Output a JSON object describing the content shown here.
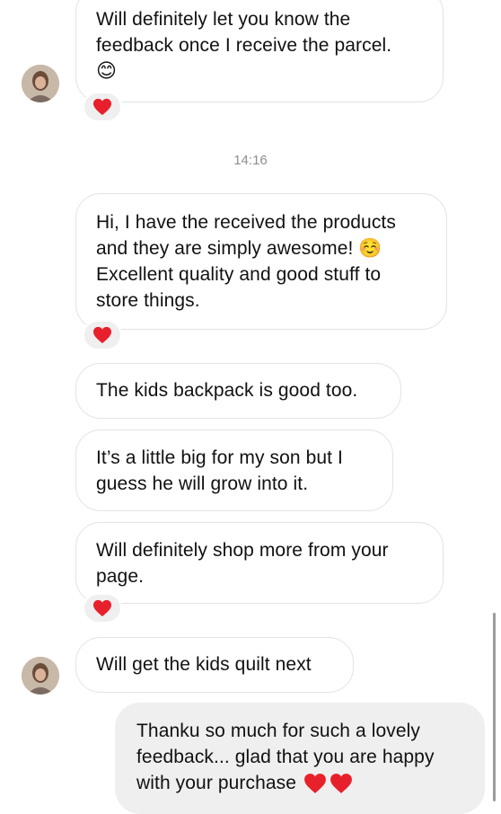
{
  "messages": {
    "m1": {
      "line1": "Will definitely let you know the",
      "line2": "feedback once I receive the parcel.",
      "emoji": "😊"
    },
    "timestamp": "14:16",
    "m2": {
      "line1": "Hi, I have the received the products",
      "line2": "and they are simply awesome! ",
      "emoji": "☺️",
      "line3": "Excellent quality and good stuff to",
      "line4": "store things."
    },
    "m3": {
      "line1": "The kids backpack is good too."
    },
    "m4": {
      "line1": "It’s a little big for my son but I",
      "line2": "guess he will grow into it."
    },
    "m5": {
      "line1": "Will definitely shop more from your",
      "line2": "page."
    },
    "m6": {
      "line1": "Will get the kids quilt next"
    },
    "sent1": {
      "line1": "Thanku so much for such a lovely",
      "line2": "feedback... glad that you are happy",
      "line3": "with your purchase "
    }
  },
  "icons": {
    "reaction": "red-heart-icon",
    "avatar": "user-avatar"
  },
  "colors": {
    "heart": "#e8202c",
    "received_bubble_border": "#e3e3e3",
    "sent_bubble_bg": "#efefef",
    "timestamp": "#8e8e8e"
  }
}
